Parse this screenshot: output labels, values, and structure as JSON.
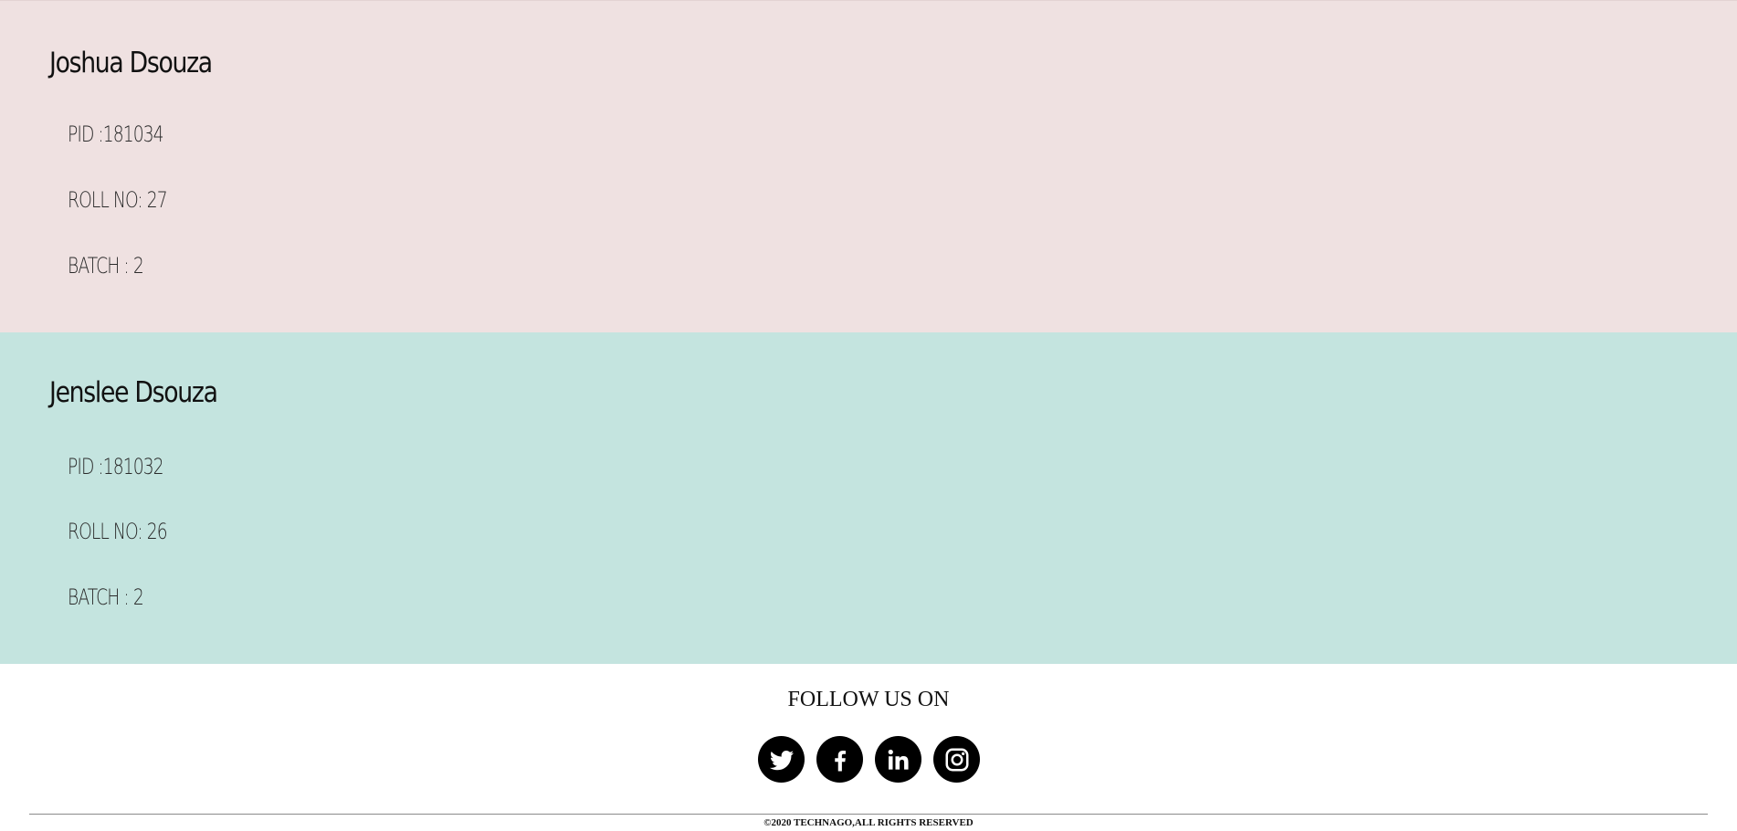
{
  "members": [
    {
      "name": "Joshua Dsouza",
      "pid": "PID :181034",
      "roll": "ROLL NO: 27",
      "batch": "BATCH : 2",
      "bg_color": "#efe1e1"
    },
    {
      "name": "Jenslee Dsouza",
      "pid": "PID :181032",
      "roll": "ROLL NO: 26",
      "batch": "BATCH : 2",
      "bg_color": "#c4e4df"
    }
  ],
  "footer": {
    "follow_title": "FOLLOW US ON",
    "social_icons": [
      "twitter-icon",
      "facebook-icon",
      "linkedin-icon",
      "instagram-icon"
    ],
    "copyright": "©2020 TECHNAGO,ALL RIGHTS RESERVED"
  }
}
